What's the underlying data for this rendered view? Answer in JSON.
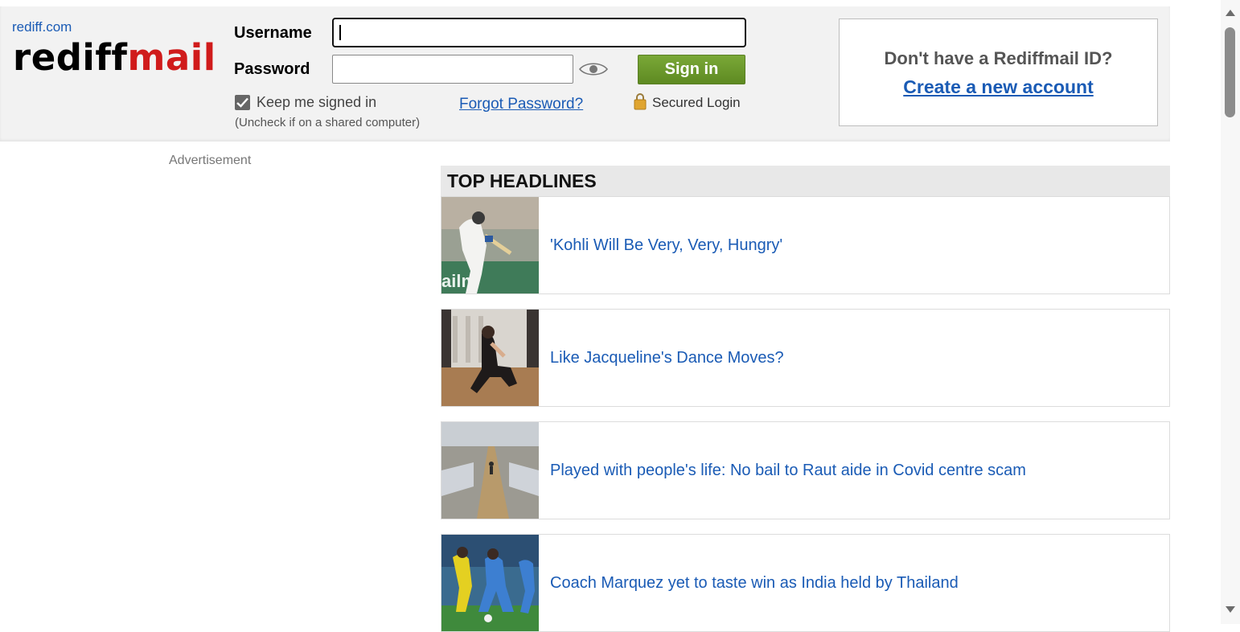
{
  "header": {
    "site_link": "rediff.com",
    "logo_part1": "rediff",
    "logo_part2": "mail"
  },
  "login": {
    "username_label": "Username",
    "username_value": "",
    "password_label": "Password",
    "password_value": "",
    "signin_label": "Sign in",
    "keep_signed_in_label": "Keep me signed in",
    "keep_signed_in_checked": true,
    "keep_signed_in_note": "(Uncheck if on a shared computer)",
    "forgot_password": "Forgot Password?",
    "secured_login": "Secured Login"
  },
  "signup": {
    "question": "Don't have a Rediffmail ID?",
    "link": "Create a new account"
  },
  "ad": {
    "label": "Advertisement"
  },
  "headlines": {
    "title": "TOP HEADLINES",
    "items": [
      {
        "title": "'Kohli Will Be Very, Very, Hungry'",
        "thumb": "cricket-batsman-image"
      },
      {
        "title": "Like Jacqueline's Dance Moves?",
        "thumb": "dancer-image"
      },
      {
        "title": "Played with people's life: No bail to Raut aide in Covid centre scam",
        "thumb": "covid-centre-image"
      },
      {
        "title": "Coach Marquez yet to taste win as India held by Thailand",
        "thumb": "football-match-image"
      }
    ]
  },
  "colors": {
    "link": "#1a5bb5",
    "logo_red": "#d01b1b",
    "signin_green": "#6b9a2c"
  }
}
